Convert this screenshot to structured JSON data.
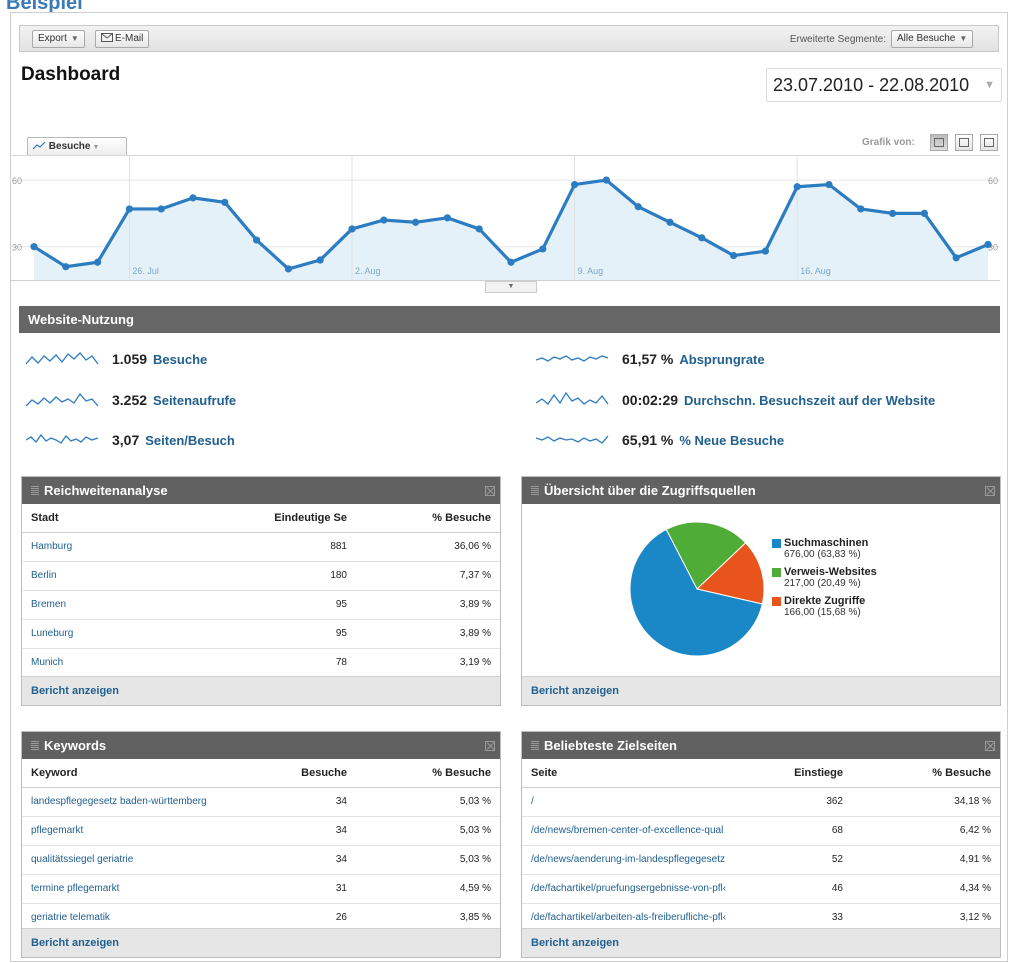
{
  "page_heading": "Beispiel",
  "toolbar": {
    "export_label": "Export",
    "email_label": "E-Mail",
    "segments_label": "Erweiterte Segmente:",
    "segments_value": "Alle Besuche"
  },
  "dashboard": {
    "title": "Dashboard",
    "date_range": "23.07.2010 - 22.08.2010"
  },
  "chart": {
    "metric_tab": "Besuche",
    "view_label": "Grafik von:"
  },
  "chart_data": {
    "type": "area",
    "series": [
      {
        "name": "Besuche",
        "values": [
          30,
          21,
          23,
          47,
          47,
          52,
          50,
          33,
          20,
          24,
          38,
          42,
          41,
          43,
          38,
          23,
          29,
          58,
          60,
          48,
          41,
          34,
          26,
          28,
          57,
          58,
          47,
          45,
          45,
          25,
          31
        ]
      }
    ],
    "x_dates": [
      "23.07.",
      "24.07.",
      "25.07.",
      "26.07.",
      "27.07.",
      "28.07.",
      "29.07.",
      "30.07.",
      "31.07.",
      "01.08.",
      "02.08.",
      "03.08.",
      "04.08.",
      "05.08.",
      "06.08.",
      "07.08.",
      "08.08.",
      "09.08.",
      "10.08.",
      "11.08.",
      "12.08.",
      "13.08.",
      "14.08.",
      "15.08.",
      "16.08.",
      "17.08.",
      "18.08.",
      "19.08.",
      "20.08.",
      "21.08.",
      "22.08."
    ],
    "x_tick_labels": [
      "26. Jul",
      "2. Aug",
      "9. Aug",
      "16. Aug"
    ],
    "y_tick_labels": [
      "60",
      "30"
    ],
    "ylim": [
      15,
      65
    ],
    "grid": true,
    "color": "#2c7cc1"
  },
  "usage": {
    "title": "Website-Nutzung",
    "metrics": [
      {
        "value": "1.059",
        "label": "Besuche"
      },
      {
        "value": "3.252",
        "label": "Seitenaufrufe"
      },
      {
        "value": "3,07",
        "label": "Seiten/Besuch"
      },
      {
        "value": "61,57 %",
        "label": "Absprungrate"
      },
      {
        "value": "00:02:29",
        "label": "Durchschn. Besuchszeit auf der Website"
      },
      {
        "value": "65,91 %",
        "label": "% Neue Besuche"
      }
    ]
  },
  "reach": {
    "title": "Reichweitenanalyse",
    "columns": [
      "Stadt",
      "Eindeutige Se",
      "% Besuche"
    ],
    "rows": [
      [
        "Hamburg",
        "881",
        "36,06 %"
      ],
      [
        "Berlin",
        "180",
        "7,37 %"
      ],
      [
        "Bremen",
        "95",
        "3,89 %"
      ],
      [
        "Luneburg",
        "95",
        "3,89 %"
      ],
      [
        "Munich",
        "78",
        "3,19 %"
      ]
    ],
    "footer": "Bericht anzeigen"
  },
  "traffic": {
    "title": "Übersicht über die Zugriffsquellen",
    "sources": [
      {
        "name": "Suchmaschinen",
        "value": "676,00 (63,83 %)",
        "share": 63.83,
        "color": "#1a87c7"
      },
      {
        "name": "Verweis-Websites",
        "value": "217,00 (20,49 %)",
        "share": 20.49,
        "color": "#4fac37"
      },
      {
        "name": "Direkte Zugriffe",
        "value": "166,00 (15,68 %)",
        "share": 15.68,
        "color": "#e8541c"
      }
    ],
    "footer": "Bericht anzeigen"
  },
  "keywords": {
    "title": "Keywords",
    "columns": [
      "Keyword",
      "Besuche",
      "% Besuche"
    ],
    "rows": [
      [
        "landespflegegesetz baden-württemberg",
        "34",
        "5,03 %"
      ],
      [
        "pflegemarkt",
        "34",
        "5,03 %"
      ],
      [
        "qualitätssiegel geriatrie",
        "34",
        "5,03 %"
      ],
      [
        "termine pflegemarkt",
        "31",
        "4,59 %"
      ],
      [
        "geriatrie telematik",
        "26",
        "3,85 %"
      ]
    ],
    "footer": "Bericht anzeigen"
  },
  "landing": {
    "title": "Beliebteste Zielseiten",
    "columns": [
      "Seite",
      "Einstiege",
      "% Besuche"
    ],
    "rows": [
      [
        "/",
        "362",
        "34,18 %"
      ],
      [
        "/de/news/bremen-center-of-excellence-qual",
        "68",
        "6,42 %"
      ],
      [
        "/de/news/aenderung-im-landespflegegesetz",
        "52",
        "4,91 %"
      ],
      [
        "/de/fachartikel/pruefungsergebnisse-von-pfl‹",
        "46",
        "4,34 %"
      ],
      [
        "/de/fachartikel/arbeiten-als-freiberufliche-pfl‹",
        "33",
        "3,12 %"
      ]
    ],
    "footer": "Bericht anzeigen"
  }
}
